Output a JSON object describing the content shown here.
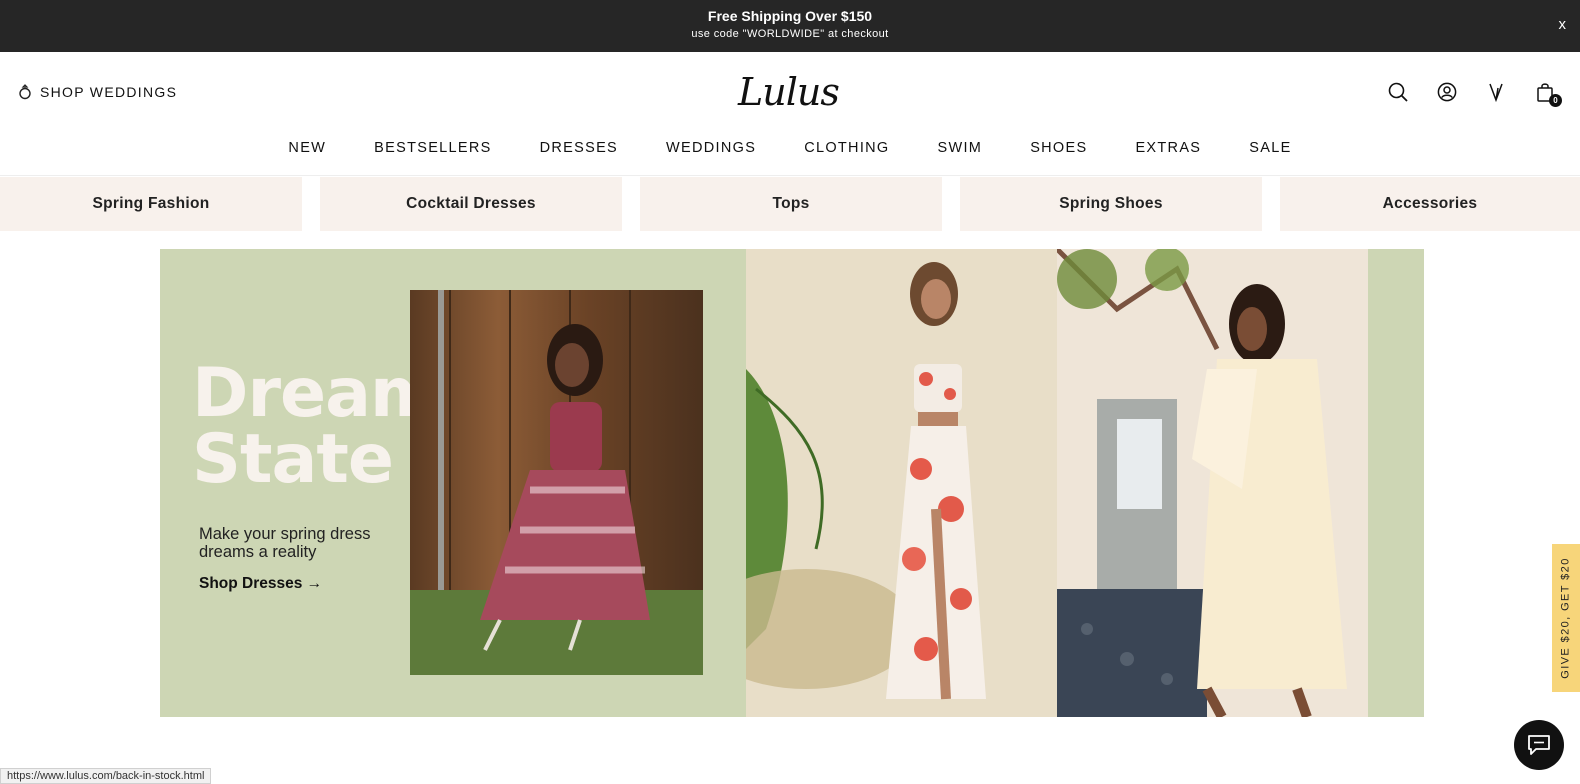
{
  "promo": {
    "title": "Free Shipping Over $150",
    "subtitle": "use code \"WORLDWIDE\" at checkout",
    "close_label": "x"
  },
  "header": {
    "shop_weddings": "SHOP WEDDINGS",
    "logo_text": "Lulus",
    "bag_count": "0",
    "icons": [
      "search-icon",
      "account-icon",
      "wishlist-icon",
      "bag-icon"
    ]
  },
  "nav": {
    "items": [
      "NEW",
      "BESTSELLERS",
      "DRESSES",
      "WEDDINGS",
      "CLOTHING",
      "SWIM",
      "SHOES",
      "EXTRAS",
      "SALE"
    ]
  },
  "tiles": {
    "items": [
      "Spring Fashion",
      "Cocktail Dresses",
      "Tops",
      "Spring Shoes",
      "Accessories"
    ]
  },
  "hero": {
    "title_line1": "Dream",
    "title_line2": "State",
    "subtitle": "Make your spring dress dreams a reality",
    "cta": "Shop Dresses →",
    "bg_color": "#cdd6b4"
  },
  "side_promo": {
    "label": "GIVE $20, GET $20",
    "color": "#f7d57a"
  },
  "status_bar": {
    "url": "https://www.lulus.com/back-in-stock.html"
  }
}
